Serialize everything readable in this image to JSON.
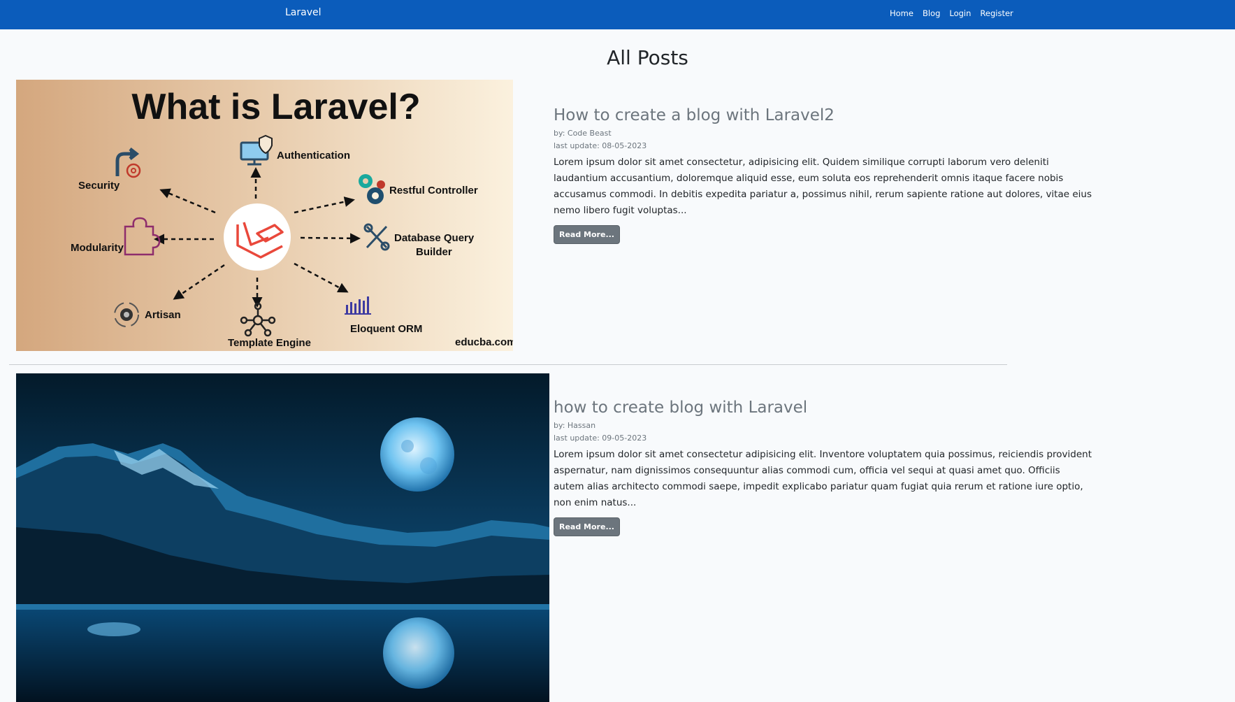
{
  "navbar": {
    "brand": "Laravel",
    "links": [
      "Home",
      "Blog",
      "Login",
      "Register"
    ],
    "color": "#0b5cbb"
  },
  "page": {
    "title": "All Posts"
  },
  "posts": [
    {
      "title": "How to create a blog with Laravel2",
      "author": "by: Code Beast",
      "updated": "last update: 08-05-2023",
      "excerpt": "Lorem ipsum dolor sit amet consectetur, adipisicing elit. Quidem similique corrupti laborum vero deleniti laudantium accusantium, doloremque aliquid esse, eum soluta eos reprehenderit omnis itaque facere nobis accusamus commodi. In debitis expedita pariatur a, possimus nihil, rerum sapiente ratione aut dolores, vitae eius nemo libero fugit voluptas...",
      "button": "Read More...",
      "image": {
        "heading": "What is Laravel?",
        "labels": {
          "authentication": "Authentication",
          "security": "Security",
          "restful": "Restful Controller",
          "modularity": "Modularity",
          "dbq1": "Database Query",
          "dbq2": "Builder",
          "artisan": "Artisan",
          "eloquent": "Eloquent ORM",
          "template": "Template Engine",
          "source": "educba.com"
        }
      }
    },
    {
      "title": "how to create blog with Laravel",
      "author": "by: Hassan",
      "updated": "last update: 09-05-2023",
      "excerpt": "Lorem ipsum dolor sit amet consectetur adipisicing elit. Inventore voluptatem quia possimus, reiciendis provident aspernatur, nam dignissimos consequuntur alias commodi cum, officia vel sequi at quasi amet quo. Officiis autem alias architecto commodi saepe, impedit explicabo pariatur quam fugiat quia rerum et ratione iure optio, non enim natus...",
      "button": "Read More..."
    }
  ]
}
